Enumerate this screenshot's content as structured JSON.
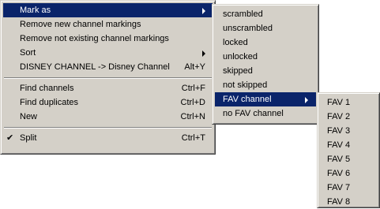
{
  "main_menu": {
    "items": [
      {
        "label": "Mark as",
        "shortcut": "",
        "submenu": true,
        "selected": true
      },
      {
        "label": "Remove new channel markings",
        "shortcut": ""
      },
      {
        "label": "Remove not existing channel markings",
        "shortcut": ""
      },
      {
        "label": "Sort",
        "shortcut": "",
        "submenu": true
      },
      {
        "label": "DISNEY CHANNEL -> Disney Channel",
        "shortcut": "Alt+Y"
      },
      {
        "label": "Find channels",
        "shortcut": "Ctrl+F"
      },
      {
        "label": "Find duplicates",
        "shortcut": "Ctrl+D"
      },
      {
        "label": "New",
        "shortcut": "Ctrl+N"
      },
      {
        "label": "Split",
        "shortcut": "Ctrl+T",
        "checked": true,
        "check_glyph": "✔"
      }
    ]
  },
  "mark_menu": {
    "items": [
      {
        "label": "scrambled"
      },
      {
        "label": "unscrambled"
      },
      {
        "label": "locked"
      },
      {
        "label": "unlocked"
      },
      {
        "label": "skipped"
      },
      {
        "label": "not skipped"
      },
      {
        "label": "FAV channel",
        "submenu": true,
        "selected": true
      },
      {
        "label": "no FAV channel"
      }
    ]
  },
  "fav_menu": {
    "items": [
      {
        "label": "FAV 1"
      },
      {
        "label": "FAV 2"
      },
      {
        "label": "FAV 3"
      },
      {
        "label": "FAV 4"
      },
      {
        "label": "FAV 5"
      },
      {
        "label": "FAV 6"
      },
      {
        "label": "FAV 7"
      },
      {
        "label": "FAV 8"
      }
    ]
  },
  "colors": {
    "menu_background": "#d4d0c8",
    "selection_background": "#0a246a",
    "selection_text": "#ffffff"
  },
  "icons": {
    "submenu_arrow": "chevron-right-icon",
    "checkmark": "checkmark-icon"
  }
}
